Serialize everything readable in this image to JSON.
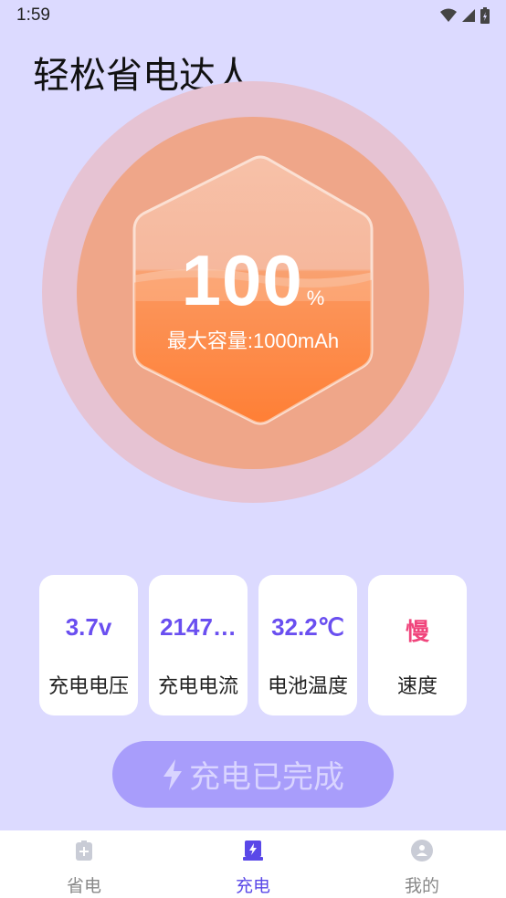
{
  "status_bar": {
    "time": "1:59",
    "icons": [
      "wifi-icon",
      "signal-icon",
      "battery-icon"
    ]
  },
  "app": {
    "title": "轻松省电达人"
  },
  "battery": {
    "level": 100,
    "level_text": "100",
    "unit": "%",
    "capacity_text": "最大容量:1000mAh"
  },
  "stats": [
    {
      "value": "3.7v",
      "label": "充电电压"
    },
    {
      "value": "2147…",
      "label": "充电电流"
    },
    {
      "value": "32.2℃",
      "label": "电池温度"
    },
    {
      "value": "慢",
      "label": "速度"
    }
  ],
  "action": {
    "icon": "lightning-icon",
    "label": "充电已完成"
  },
  "nav": {
    "items": [
      {
        "label": "省电",
        "icon": "battery-plus-icon",
        "active": false
      },
      {
        "label": "充电",
        "icon": "charge-icon",
        "active": true
      },
      {
        "label": "我的",
        "icon": "user-icon",
        "active": false
      }
    ]
  },
  "colors": {
    "background": "#dcdaff",
    "accent": "#6a4ff0",
    "slow": "#f0457c",
    "button": "#a89dfb",
    "nav_active": "#5a48e8",
    "circle": "#efa689",
    "ring": "#e6c3d3"
  }
}
